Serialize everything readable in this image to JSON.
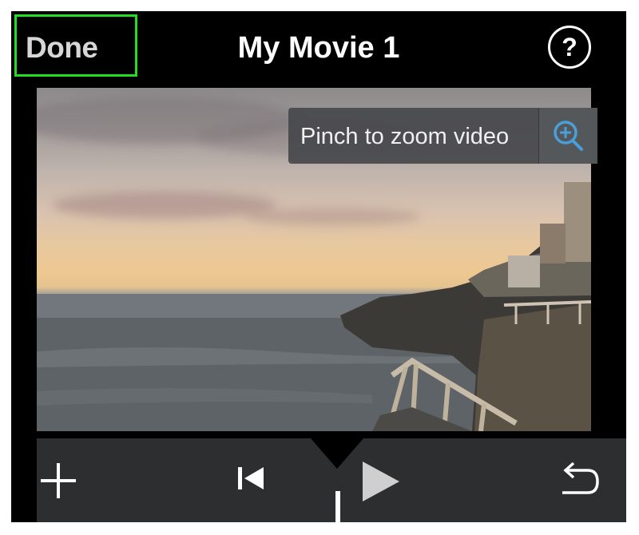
{
  "topbar": {
    "done_label": "Done",
    "title": "My Movie 1",
    "help_label": "?"
  },
  "video": {
    "tooltip_text": "Pinch to zoom video",
    "tooltip_icon": "zoom-in-icon"
  },
  "toolbar": {
    "icons": [
      "add-icon",
      "skip-to-start-icon",
      "play-icon",
      "undo-icon"
    ]
  },
  "colors": {
    "highlight_border": "#22dd22",
    "toolbar_bg": "#2d2e30",
    "accent_blue": "#4a9fd8"
  }
}
